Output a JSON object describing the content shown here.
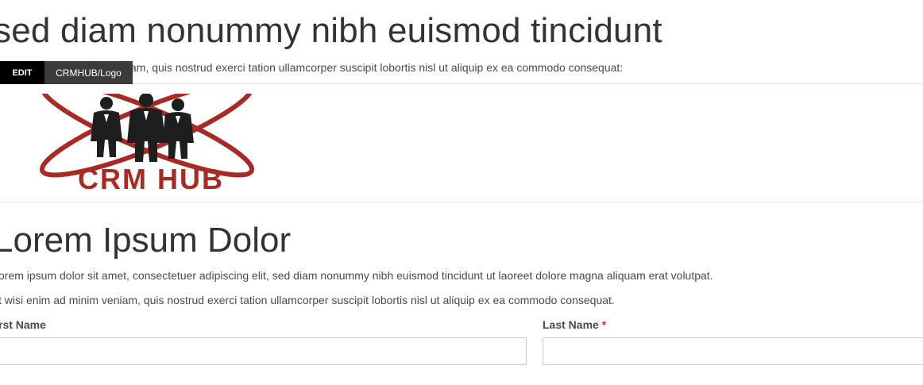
{
  "top_section": {
    "heading": "sed diam nonummy nibh euismod tincidunt",
    "paragraph": "am, quis nostrud exerci tation ullamcorper suscipit lobortis nisl ut aliquip ex ea commodo consequat:"
  },
  "edit_toolbar": {
    "edit_label": "EDIT",
    "path_label": "CRMHUB/Logo"
  },
  "logo": {
    "text": "CRM HUB",
    "brand_color": "#a82a25"
  },
  "main_section": {
    "heading": "Lorem Ipsum Dolor",
    "paragraph_1": "orem ipsum dolor sit amet, consectetuer adipiscing elit, sed diam nonummy nibh euismod tincidunt ut laoreet dolore magna aliquam erat volutpat.",
    "paragraph_2": "t wisi enim ad minim veniam, quis nostrud exerci tation ullamcorper suscipit lobortis nisl ut aliquip ex ea commodo consequat."
  },
  "form": {
    "first_name_label": "rst Name",
    "first_name_value": "",
    "last_name_label": "Last Name",
    "last_name_required": "*",
    "last_name_value": ""
  }
}
